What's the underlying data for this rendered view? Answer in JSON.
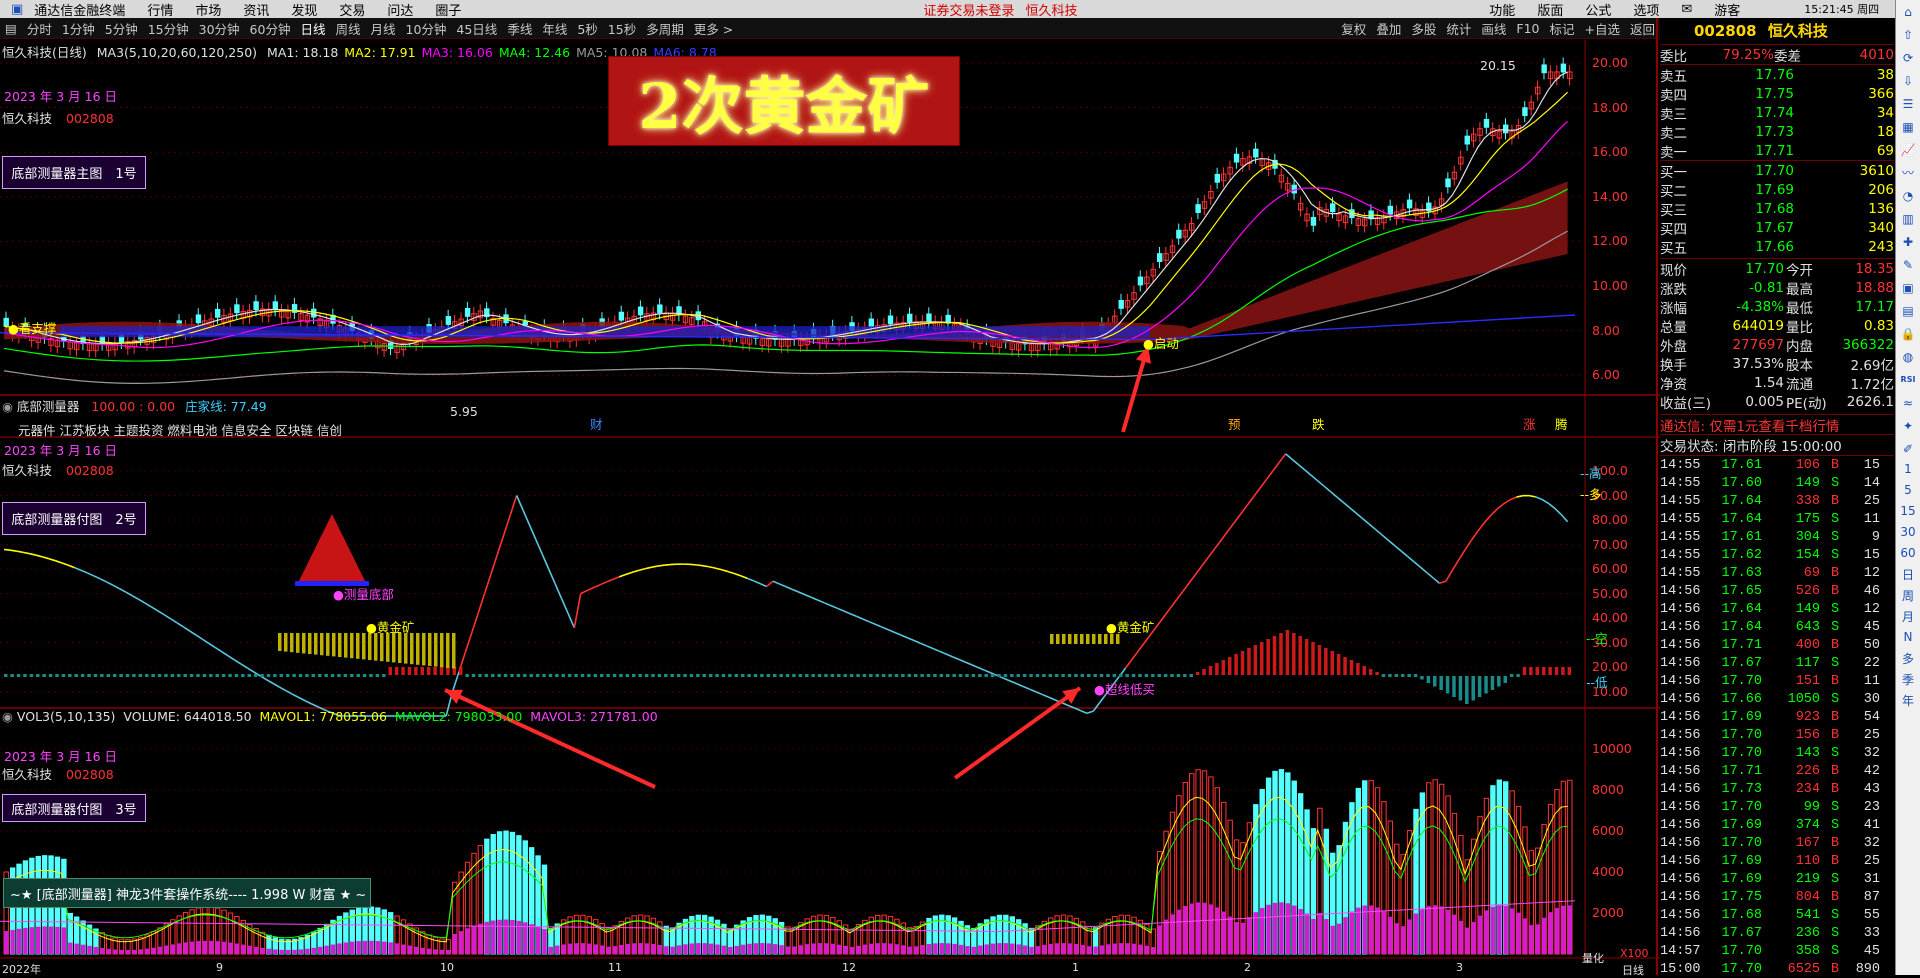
{
  "menubar": {
    "app_title": "通达信金融终端",
    "items": [
      "行情",
      "市场",
      "资讯",
      "发现",
      "交易",
      "问达",
      "圈子"
    ],
    "status_warning": "证券交易未登录",
    "stock_title": "恒久科技",
    "right_items": [
      "功能",
      "版面",
      "公式",
      "选项"
    ],
    "user": "游客",
    "time": "15:21:45 周四"
  },
  "periodbar": {
    "items": [
      "分时",
      "1分钟",
      "5分钟",
      "15分钟",
      "30分钟",
      "60分钟",
      "日线",
      "周线",
      "月线",
      "10分钟",
      "45日线",
      "季线",
      "年线",
      "5秒",
      "15秒",
      "多周期",
      "更多 >"
    ],
    "active": "日线",
    "right_items": [
      "复权",
      "叠加",
      "多股",
      "统计",
      "画线",
      "F10",
      "标记",
      "+自选",
      "返回"
    ]
  },
  "main_chart": {
    "header": "恒久科技(日线)",
    "ma_header": "MA3(5,10,20,60,120,250)",
    "ma": [
      {
        "label": "MA1: 18.18",
        "color": "#e0e0e0"
      },
      {
        "label": "MA2: 17.91",
        "color": "#ffff00"
      },
      {
        "label": "MA3: 16.06",
        "color": "#ff00ff"
      },
      {
        "label": "MA4: 12.46",
        "color": "#00ff00"
      },
      {
        "label": "MA5: 10.08",
        "color": "#9a9a9a"
      },
      {
        "label": "MA6: 8.78",
        "color": "#3a3aff"
      }
    ],
    "date": "2023 年 3 月 16 日",
    "stock_name": "恒久科技",
    "stock_code": "002808",
    "indicator_label": "底部测量器主图　1号",
    "banner": "2次黄金矿",
    "yticks": [
      "20.00",
      "18.00",
      "16.00",
      "14.00",
      "12.00",
      "10.00",
      "8.00",
      "6.00"
    ],
    "high_label": "20.15",
    "low_label": "5.95",
    "start_label": "●启动",
    "bottom_marks": [
      "财",
      "预",
      "跌",
      "涨",
      "腾"
    ],
    "top_left_label": "●看支撑"
  },
  "sub_chart1": {
    "header": "底部测量器",
    "values": "100.00 : 0.00",
    "line": "庄家线: 77.49",
    "concepts": "元器件 江苏板块 主题投资 燃料电池 信息安全 区块链 信创",
    "date": "2023 年 3 月 16 日",
    "stock_name": "恒久科技",
    "stock_code": "002808",
    "indicator_label": "底部测量器付图　2号",
    "yticks": [
      "100.0",
      "90.00",
      "80.00",
      "70.00",
      "60.00",
      "50.00",
      "40.00",
      "30.00",
      "20.00",
      "10.00"
    ],
    "right_marks": [
      "高",
      "多",
      "空",
      "低"
    ],
    "gold_label": "●黄金矿",
    "measure_label": "●测量底部",
    "buy_label": "●超线低买"
  },
  "sub_chart2": {
    "header": "VOL3(5,10,135)",
    "volume": "VOLUME: 644018.50",
    "mavol1": "MAVOL1: 778055.06",
    "mavol2": "MAVOL2: 798033.00",
    "mavol3": "MAVOL3: 271781.00",
    "date": "2023 年 3 月 16 日",
    "stock_name": "恒久科技",
    "stock_code": "002808",
    "indicator_label": "底部测量器付图　3号",
    "yticks": [
      "10000",
      "8000",
      "6000",
      "4000",
      "2000"
    ],
    "unit": "X100",
    "unit_label": "量化",
    "promo": "~★ [底部测量器] 神龙3件套操作系统---- 1.998 W 财富 ★ ~"
  },
  "xaxis": {
    "labels": [
      "2022年",
      "9",
      "10",
      "11",
      "12",
      "1",
      "2",
      "3"
    ],
    "period": "日线"
  },
  "quote": {
    "code": "002808",
    "name": "恒久科技",
    "weibi_label": "委比",
    "weibi": "79.25%",
    "weicha_label": "委差",
    "weicha": "4010",
    "asks": [
      {
        "label": "卖五",
        "price": "17.76",
        "vol": "38"
      },
      {
        "label": "卖四",
        "price": "17.75",
        "vol": "366"
      },
      {
        "label": "卖三",
        "price": "17.74",
        "vol": "34"
      },
      {
        "label": "卖二",
        "price": "17.73",
        "vol": "18"
      },
      {
        "label": "卖一",
        "price": "17.71",
        "vol": "69"
      }
    ],
    "bids": [
      {
        "label": "买一",
        "price": "17.70",
        "vol": "3610"
      },
      {
        "label": "买二",
        "price": "17.69",
        "vol": "206"
      },
      {
        "label": "买三",
        "price": "17.68",
        "vol": "136"
      },
      {
        "label": "买四",
        "price": "17.67",
        "vol": "340"
      },
      {
        "label": "买五",
        "price": "17.66",
        "vol": "243"
      }
    ],
    "stats": [
      {
        "l1": "现价",
        "v1": "17.70",
        "c1": "#00ff00",
        "l2": "今开",
        "v2": "18.35",
        "c2": "#ff3333"
      },
      {
        "l1": "涨跌",
        "v1": "-0.81",
        "c1": "#00ff00",
        "l2": "最高",
        "v2": "18.88",
        "c2": "#ff3333"
      },
      {
        "l1": "涨幅",
        "v1": "-4.38%",
        "c1": "#00ff00",
        "l2": "最低",
        "v2": "17.17",
        "c2": "#00ff00"
      },
      {
        "l1": "总量",
        "v1": "644019",
        "c1": "#ffff00",
        "l2": "量比",
        "v2": "0.83",
        "c2": "#ffff00"
      },
      {
        "l1": "外盘",
        "v1": "277697",
        "c1": "#ff3333",
        "l2": "内盘",
        "v2": "366322",
        "c2": "#00ff00"
      },
      {
        "l1": "换手",
        "v1": "37.53%",
        "c1": "#e0e0e0",
        "l2": "股本",
        "v2": "2.69亿",
        "c2": "#e0e0e0"
      },
      {
        "l1": "净资",
        "v1": "1.54",
        "c1": "#e0e0e0",
        "l2": "流通",
        "v2": "1.72亿",
        "c2": "#e0e0e0"
      },
      {
        "l1": "收益(三)",
        "v1": "0.005",
        "c1": "#e0e0e0",
        "l2": "PE(动)",
        "v2": "2626.1",
        "c2": "#e0e0e0"
      }
    ],
    "promo": "通达信: 仅需1元查看千档行情",
    "trade_status": "交易状态: 闭市阶段 15:00:00",
    "ticks": [
      [
        "14:55",
        "17.61",
        "106",
        "B",
        "15"
      ],
      [
        "14:55",
        "17.60",
        "149",
        "S",
        "14"
      ],
      [
        "14:55",
        "17.64",
        "338",
        "B",
        "25"
      ],
      [
        "14:55",
        "17.64",
        "175",
        "S",
        "11"
      ],
      [
        "14:55",
        "17.61",
        "304",
        "S",
        "9"
      ],
      [
        "14:55",
        "17.62",
        "154",
        "S",
        "15"
      ],
      [
        "14:55",
        "17.63",
        "69",
        "B",
        "12"
      ],
      [
        "14:56",
        "17.65",
        "526",
        "B",
        "46"
      ],
      [
        "14:56",
        "17.64",
        "149",
        "S",
        "12"
      ],
      [
        "14:56",
        "17.64",
        "643",
        "S",
        "45"
      ],
      [
        "14:56",
        "17.71",
        "400",
        "B",
        "50"
      ],
      [
        "14:56",
        "17.67",
        "117",
        "S",
        "22"
      ],
      [
        "14:56",
        "17.70",
        "151",
        "B",
        "11"
      ],
      [
        "14:56",
        "17.66",
        "1050",
        "S",
        "30"
      ],
      [
        "14:56",
        "17.69",
        "923",
        "B",
        "54"
      ],
      [
        "14:56",
        "17.70",
        "156",
        "B",
        "25"
      ],
      [
        "14:56",
        "17.70",
        "143",
        "S",
        "32"
      ],
      [
        "14:56",
        "17.71",
        "226",
        "B",
        "42"
      ],
      [
        "14:56",
        "17.73",
        "234",
        "B",
        "43"
      ],
      [
        "14:56",
        "17.70",
        "99",
        "S",
        "23"
      ],
      [
        "14:56",
        "17.69",
        "374",
        "S",
        "41"
      ],
      [
        "14:56",
        "17.70",
        "167",
        "B",
        "32"
      ],
      [
        "14:56",
        "17.69",
        "110",
        "B",
        "25"
      ],
      [
        "14:56",
        "17.69",
        "219",
        "S",
        "31"
      ],
      [
        "14:56",
        "17.75",
        "804",
        "B",
        "87"
      ],
      [
        "14:56",
        "17.68",
        "541",
        "S",
        "55"
      ],
      [
        "14:56",
        "17.67",
        "236",
        "S",
        "33"
      ],
      [
        "14:57",
        "17.70",
        "358",
        "S",
        "45"
      ],
      [
        "15:00",
        "17.70",
        "6525",
        "B",
        "890"
      ]
    ]
  },
  "side_icons": [
    "home-icon",
    "up-icon",
    "refresh-icon",
    "down-icon",
    "list-icon",
    "grid-icon",
    "chart-icon",
    "line-icon",
    "pie-icon",
    "bars-icon",
    "cross-icon",
    "note-icon",
    "calendar-icon",
    "table-icon",
    "lock-icon",
    "globe-icon",
    "rsi-icon",
    "wave-icon",
    "compass-icon",
    "pen-icon"
  ],
  "side_letters": [
    "1",
    "5",
    "15",
    "30",
    "60",
    "日",
    "周",
    "月",
    "N",
    "多",
    "季",
    "年"
  ]
}
